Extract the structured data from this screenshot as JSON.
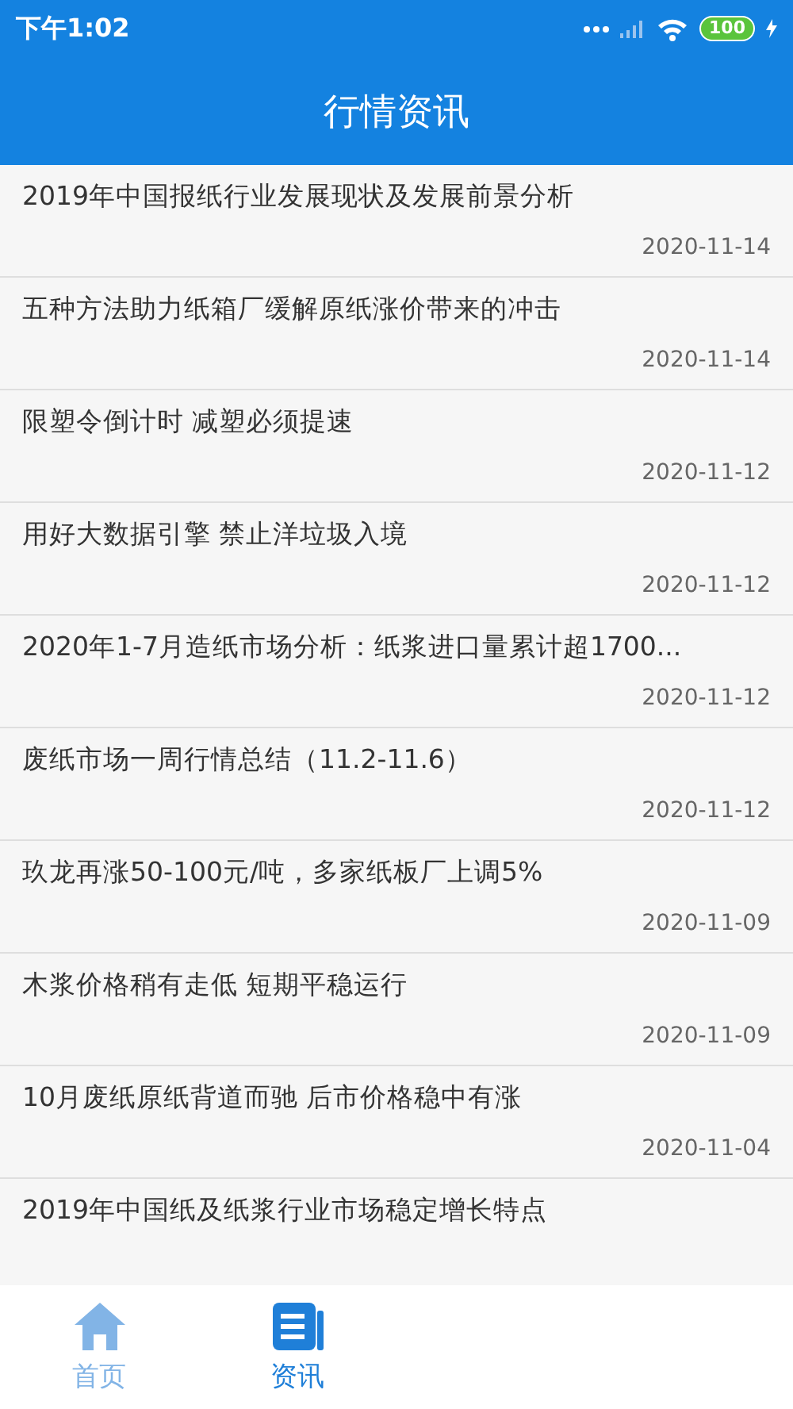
{
  "status_bar": {
    "time": "下午1:02",
    "battery": "100"
  },
  "header": {
    "title": "行情资讯"
  },
  "articles": [
    {
      "title": "2019年中国报纸行业发展现状及发展前景分析",
      "date": "2020-11-14"
    },
    {
      "title": "五种方法助力纸箱厂缓解原纸涨价带来的冲击",
      "date": "2020-11-14"
    },
    {
      "title": "限塑令倒计时 减塑必须提速",
      "date": "2020-11-12"
    },
    {
      "title": "用好大数据引擎 禁止洋垃圾入境",
      "date": "2020-11-12"
    },
    {
      "title": "2020年1-7月造纸市场分析：纸浆进口量累计超1700...",
      "date": "2020-11-12"
    },
    {
      "title": "废纸市场一周行情总结（11.2-11.6）",
      "date": "2020-11-12"
    },
    {
      "title": "玖龙再涨50-100元/吨，多家纸板厂上调5%",
      "date": "2020-11-09"
    },
    {
      "title": "木浆价格稍有走低 短期平稳运行",
      "date": "2020-11-09"
    },
    {
      "title": "10月废纸原纸背道而驰 后市价格稳中有涨",
      "date": "2020-11-04"
    },
    {
      "title": "2019年中国纸及纸浆行业市场稳定增长特点"
    }
  ],
  "bottom_nav": [
    {
      "label": "首页",
      "kind": "home",
      "selected": false
    },
    {
      "label": "资讯",
      "kind": "news",
      "selected": true
    }
  ]
}
